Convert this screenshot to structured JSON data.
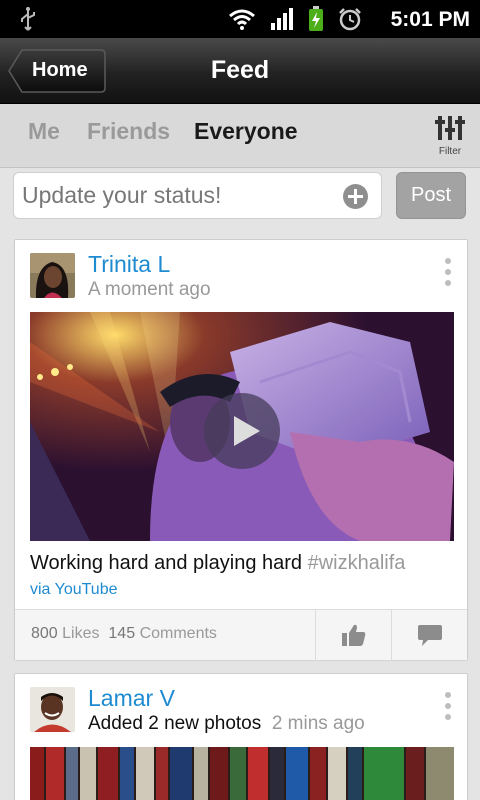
{
  "status_bar": {
    "time": "5:01 PM"
  },
  "action_bar": {
    "back_label": "Home",
    "title": "Feed"
  },
  "tabs": [
    {
      "label": "Me",
      "active": false
    },
    {
      "label": "Friends",
      "active": false
    },
    {
      "label": "Everyone",
      "active": true
    }
  ],
  "filter": {
    "label": "Filter"
  },
  "status_update": {
    "placeholder": "Update your status!",
    "post_label": "Post"
  },
  "posts": [
    {
      "author": "Trinita L",
      "time": "A moment ago",
      "caption": "Working hard and playing hard",
      "hashtag": "#wizkhalifa",
      "via": "via YouTube",
      "likes_count": "800",
      "likes_label": "Likes",
      "comments_count": "145",
      "comments_label": "Comments"
    },
    {
      "author": "Lamar V",
      "action": "Added 2 new photos",
      "time": "2 mins ago"
    }
  ],
  "colors": {
    "link": "#1e8bd1",
    "muted": "#999999",
    "action_bar": "#222222"
  }
}
